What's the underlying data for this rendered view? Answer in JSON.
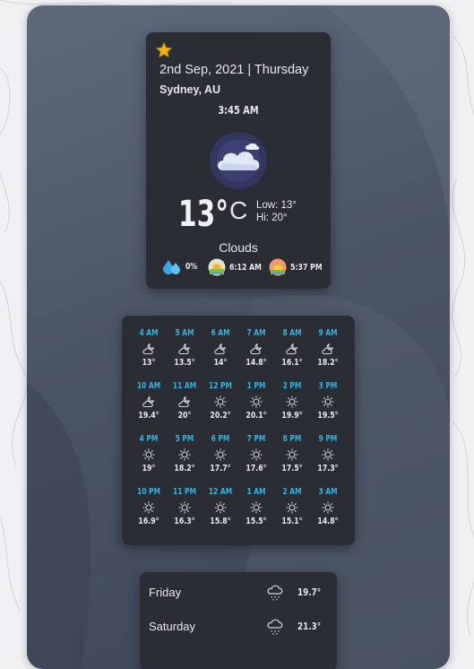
{
  "current": {
    "date": "2nd Sep, 2021 | Thursday",
    "location": "Sydney, AU",
    "time": "3:45 AM",
    "temperature": "13°",
    "unit": "C",
    "low": "Low: 13°",
    "high": "Hi: 20°",
    "condition": "Clouds",
    "humidity": "0%",
    "sunrise": "6:12 AM",
    "sunset": "5:37 PM",
    "favorite_icon": "star-icon",
    "condition_icon": "cloud-moon-icon"
  },
  "hourly": [
    {
      "time": "4 AM",
      "temp": "13°",
      "icon": "cloudy-night-icon"
    },
    {
      "time": "5 AM",
      "temp": "13.5°",
      "icon": "cloudy-night-icon"
    },
    {
      "time": "6 AM",
      "temp": "14°",
      "icon": "cloudy-night-icon"
    },
    {
      "time": "7 AM",
      "temp": "14.8°",
      "icon": "cloudy-night-icon"
    },
    {
      "time": "8 AM",
      "temp": "16.1°",
      "icon": "cloudy-night-icon"
    },
    {
      "time": "9 AM",
      "temp": "18.2°",
      "icon": "cloudy-night-icon"
    },
    {
      "time": "10 AM",
      "temp": "19.4°",
      "icon": "cloudy-night-icon"
    },
    {
      "time": "11 AM",
      "temp": "20°",
      "icon": "cloudy-night-icon"
    },
    {
      "time": "12 PM",
      "temp": "20.2°",
      "icon": "sun-icon"
    },
    {
      "time": "1 PM",
      "temp": "20.1°",
      "icon": "sun-icon"
    },
    {
      "time": "2 PM",
      "temp": "19.9°",
      "icon": "sun-icon"
    },
    {
      "time": "3 PM",
      "temp": "19.5°",
      "icon": "sun-icon"
    },
    {
      "time": "4 PM",
      "temp": "19°",
      "icon": "sun-icon"
    },
    {
      "time": "5 PM",
      "temp": "18.2°",
      "icon": "sun-icon"
    },
    {
      "time": "6 PM",
      "temp": "17.7°",
      "icon": "sun-icon"
    },
    {
      "time": "7 PM",
      "temp": "17.6°",
      "icon": "sun-icon"
    },
    {
      "time": "8 PM",
      "temp": "17.5°",
      "icon": "sun-icon"
    },
    {
      "time": "9 PM",
      "temp": "17.3°",
      "icon": "sun-icon"
    },
    {
      "time": "10 PM",
      "temp": "16.9°",
      "icon": "sun-icon"
    },
    {
      "time": "11 PM",
      "temp": "16.3°",
      "icon": "sun-icon"
    },
    {
      "time": "12 AM",
      "temp": "15.8°",
      "icon": "sun-icon"
    },
    {
      "time": "1 AM",
      "temp": "15.5°",
      "icon": "sun-icon"
    },
    {
      "time": "2 AM",
      "temp": "15.1°",
      "icon": "sun-icon"
    },
    {
      "time": "3 AM",
      "temp": "14.8°",
      "icon": "sun-icon"
    }
  ],
  "daily": [
    {
      "day": "Friday",
      "temp": "19.7°",
      "icon": "rain-cloud-icon"
    },
    {
      "day": "Saturday",
      "temp": "21.3°",
      "icon": "rain-cloud-icon"
    }
  ],
  "colors": {
    "card": "#2a2d33",
    "hour_label": "#32b3e0",
    "text": "#e6e8ec",
    "star": "#f5b301"
  }
}
